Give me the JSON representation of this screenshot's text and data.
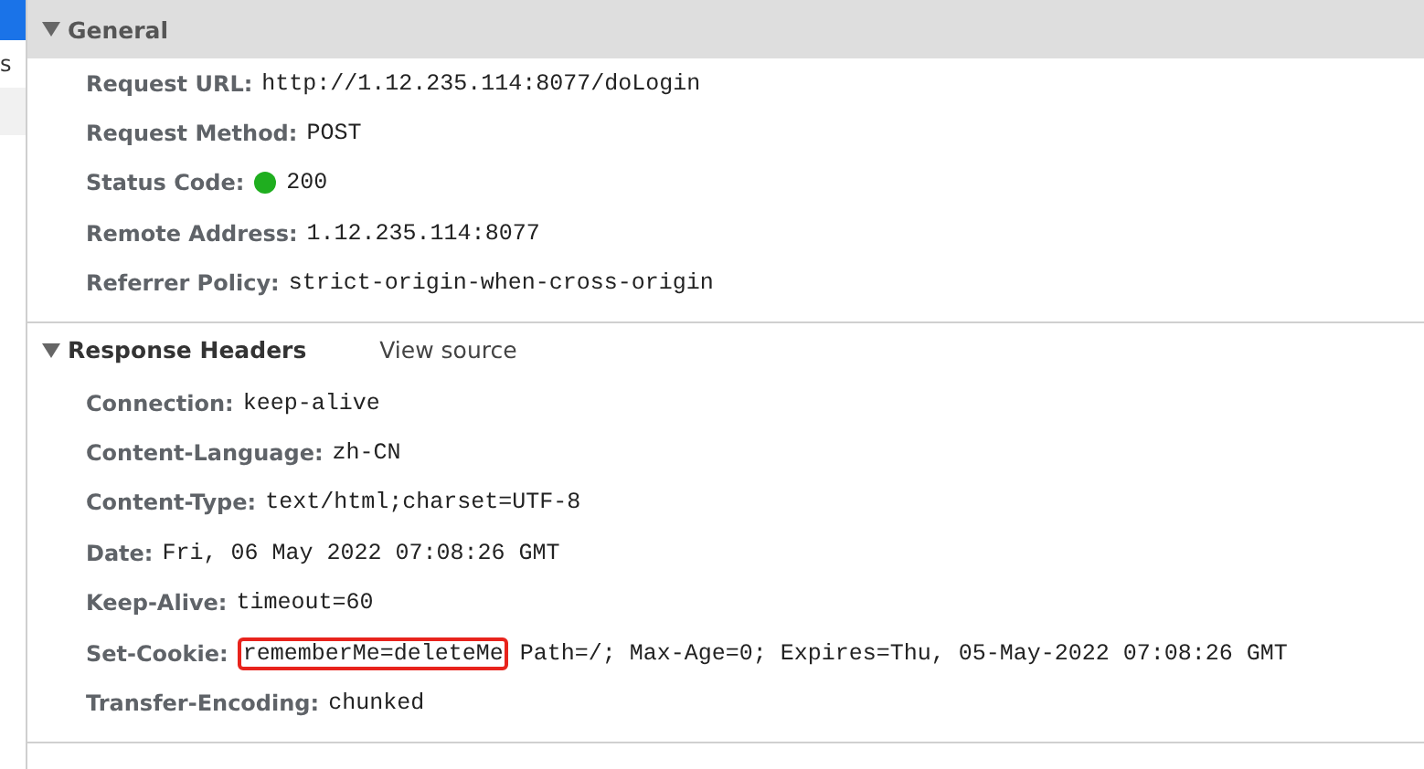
{
  "sidebar": {
    "items": [
      {
        "selected": true
      },
      {
        "label": "s",
        "selected": false
      },
      {
        "selected": false
      }
    ]
  },
  "sections": [
    {
      "title": "General",
      "expanded": true,
      "selected": true,
      "rows": [
        {
          "name": "Request URL:",
          "parts": [
            {
              "text": "http://1.12.235.114:8077/doLogin",
              "boxed": false
            }
          ]
        },
        {
          "name": "Request Method:",
          "parts": [
            {
              "text": "POST",
              "boxed": false
            }
          ]
        },
        {
          "name": "Status Code:",
          "status_dot": true,
          "parts": [
            {
              "text": "200",
              "boxed": false
            }
          ]
        },
        {
          "name": "Remote Address:",
          "parts": [
            {
              "text": "1.12.235.114:8077",
              "boxed": false
            }
          ]
        },
        {
          "name": "Referrer Policy:",
          "parts": [
            {
              "text": "strict-origin-when-cross-origin",
              "boxed": false
            }
          ]
        }
      ]
    },
    {
      "title": "Response Headers",
      "link": "View source",
      "expanded": true,
      "selected": false,
      "rows": [
        {
          "name": "Connection:",
          "parts": [
            {
              "text": "keep-alive",
              "boxed": false
            }
          ]
        },
        {
          "name": "Content-Language:",
          "parts": [
            {
              "text": "zh-CN",
              "boxed": false
            }
          ]
        },
        {
          "name": "Content-Type:",
          "parts": [
            {
              "text": "text/html;charset=UTF-8",
              "boxed": false
            }
          ]
        },
        {
          "name": "Date:",
          "parts": [
            {
              "text": "Fri, 06 May 2022 07:08:26 GMT",
              "boxed": false
            }
          ]
        },
        {
          "name": "Keep-Alive:",
          "parts": [
            {
              "text": "timeout=60",
              "boxed": false
            }
          ]
        },
        {
          "name": "Set-Cookie:",
          "parts": [
            {
              "text": "rememberMe=deleteMe",
              "boxed": true
            },
            {
              "text": "Path=/; Max-Age=0; Expires=Thu, 05-May-2022 07:08:26 GMT",
              "boxed": false
            }
          ]
        },
        {
          "name": "Transfer-Encoding:",
          "parts": [
            {
              "text": "chunked",
              "boxed": false
            }
          ]
        }
      ]
    }
  ]
}
